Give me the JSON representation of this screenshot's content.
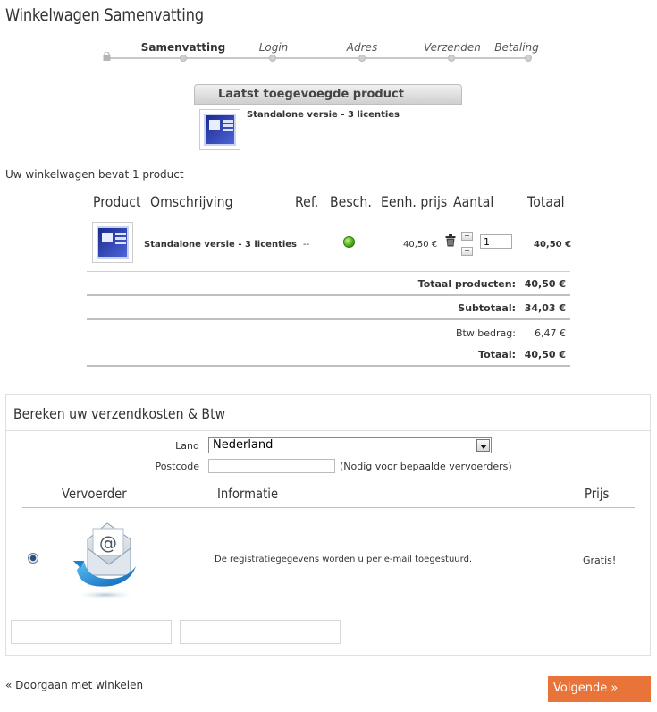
{
  "page": {
    "title": "Winkelwagen Samenvatting"
  },
  "steps": [
    {
      "label": "Samenvatting",
      "active": true
    },
    {
      "label": "Login",
      "active": false
    },
    {
      "label": "Adres",
      "active": false
    },
    {
      "label": "Verzenden",
      "active": false
    },
    {
      "label": "Betaling",
      "active": false
    }
  ],
  "last_added": {
    "header": "Laatst toegevoegde product",
    "product_name": "Standalone versie - 3 licenties"
  },
  "cart": {
    "count_text": "Uw winkelwagen bevat 1 product",
    "headers": {
      "product": "Product",
      "description": "Omschrijving",
      "ref": "Ref.",
      "availability": "Besch.",
      "unit_price": "Eenh. prijs",
      "quantity": "Aantal",
      "total": "Totaal"
    },
    "row": {
      "name": "Standalone versie - 3 licenties",
      "ref": "--",
      "unit_price": "40,50 €",
      "quantity": "1",
      "qty_plus": "+",
      "qty_minus": "−",
      "total": "40,50 €"
    },
    "totals": {
      "products_label": "Totaal producten:",
      "products_value": "40,50 €",
      "subtotal_label": "Subtotaal:",
      "subtotal_value": "34,03 €",
      "vat_label": "Btw bedrag:",
      "vat_value": "6,47 €",
      "total_label": "Totaal:",
      "total_value": "40,50 €"
    }
  },
  "shipping": {
    "title": "Bereken uw verzendkosten & Btw",
    "country_label": "Land",
    "country_value": "Nederland",
    "postcode_label": "Postcode",
    "postcode_value": "",
    "postcode_hint": "(Nodig voor bepaalde vervoerders)",
    "headers": {
      "carrier": "Vervoerder",
      "info": "Informatie",
      "price": "Prijs"
    },
    "carrier": {
      "info": "De registratiegegevens worden u per e-mail toegestuurd.",
      "price": "Gratis!",
      "selected": true
    }
  },
  "nav": {
    "continue_label": "« Doorgaan met winkelen",
    "next_label": "Volgende »"
  },
  "colors": {
    "accent": "#e8743a",
    "available": "#3c9a10"
  }
}
